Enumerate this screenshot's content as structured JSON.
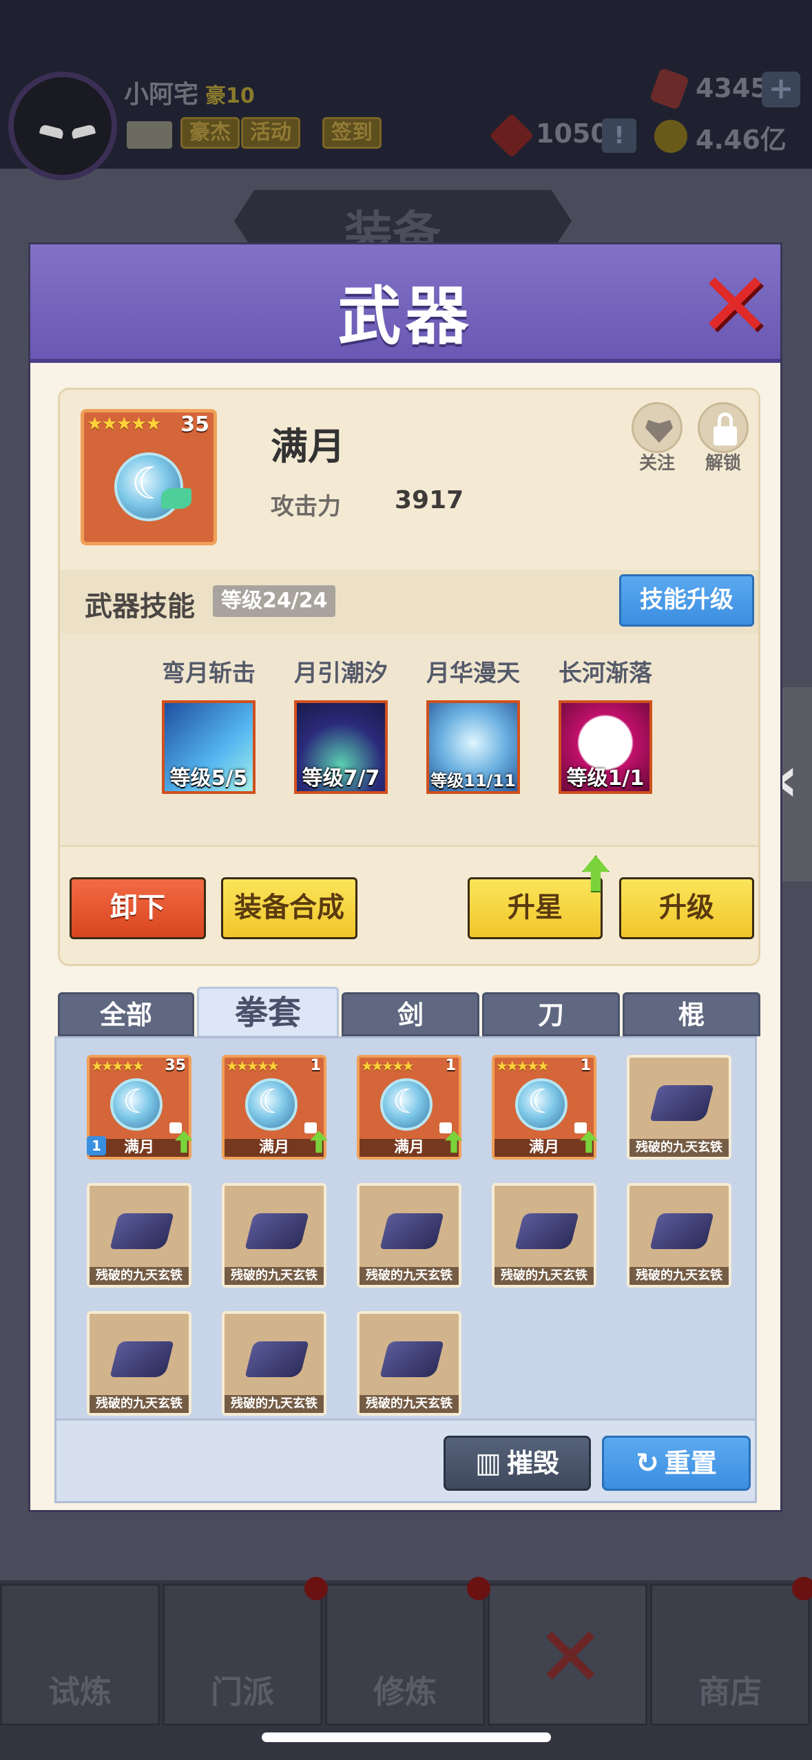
{
  "player": {
    "name": "小阿宅",
    "vip": "豪10",
    "tags": [
      "豪杰",
      "活动",
      "签到"
    ]
  },
  "resources": {
    "gems": "4345",
    "tokens": "1050",
    "gold": "4.46亿",
    "plus": "+",
    "alert": "!"
  },
  "background": {
    "banner": "装备"
  },
  "modal": {
    "title": "武器",
    "item": {
      "name": "满月",
      "stars": "★★★★★",
      "level": "35",
      "attack_label": "攻击力",
      "attack_value": "3917"
    },
    "corner": {
      "follow": "关注",
      "unlock": "解锁"
    },
    "skill": {
      "title": "武器技能",
      "level_badge": "等级24/24",
      "upgrade": "技能升级",
      "items": [
        {
          "name": "弯月斩击",
          "level": "等级5/5"
        },
        {
          "name": "月引潮汐",
          "level": "等级7/7"
        },
        {
          "name": "月华漫天",
          "level": "等级11/11"
        },
        {
          "name": "长河渐落",
          "level": "等级1/1"
        }
      ]
    },
    "actions": {
      "unequip": "卸下",
      "synthesize": "装备合成",
      "star_up": "升星",
      "upgrade": "升级"
    },
    "tabs": [
      "全部",
      "拳套",
      "剑",
      "刀",
      "棍"
    ],
    "active_tab": "拳套",
    "grid": {
      "weapons": [
        {
          "label": "满月",
          "stars": "★★★★★",
          "level": "35",
          "badge": "1"
        },
        {
          "label": "满月",
          "stars": "★★★★★",
          "level": "1"
        },
        {
          "label": "满月",
          "stars": "★★★★★",
          "level": "1"
        },
        {
          "label": "满月",
          "stars": "★★★★★",
          "level": "1"
        }
      ],
      "iron_label": "残破的九天玄铁"
    },
    "bottom": {
      "destroy": "摧毁",
      "reset": "重置"
    }
  },
  "nav": [
    "试炼",
    "门派",
    "修炼",
    "",
    "商店"
  ],
  "colors": {
    "header_purple": "#7565bf",
    "accent_blue": "#4a9ae8",
    "close_red": "#e02a2a",
    "weapon_orange": "#d4663a",
    "button_yellow": "#f5d63c",
    "button_red": "#e4552e"
  }
}
